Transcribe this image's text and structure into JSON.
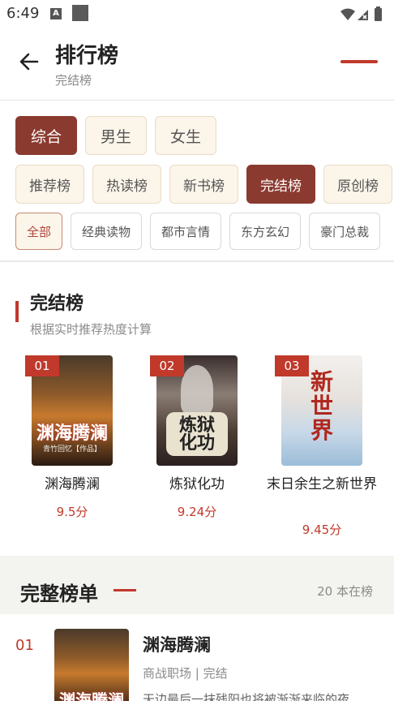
{
  "status_bar": {
    "time": "6:49",
    "notification_badge": "A"
  },
  "header": {
    "title": "排行榜",
    "subtitle": "完结榜"
  },
  "gender_tabs": [
    {
      "label": "综合",
      "active": true
    },
    {
      "label": "男生",
      "active": false
    },
    {
      "label": "女生",
      "active": false
    }
  ],
  "rank_tabs": [
    {
      "label": "推荐榜",
      "active": false
    },
    {
      "label": "热读榜",
      "active": false
    },
    {
      "label": "新书榜",
      "active": false
    },
    {
      "label": "完结榜",
      "active": true
    },
    {
      "label": "原创榜",
      "active": false
    }
  ],
  "category_tabs": [
    {
      "label": "全部",
      "active": true
    },
    {
      "label": "经典读物",
      "active": false
    },
    {
      "label": "都市言情",
      "active": false
    },
    {
      "label": "东方玄幻",
      "active": false
    },
    {
      "label": "豪门总裁",
      "active": false
    }
  ],
  "section": {
    "title": "完结榜",
    "subtitle": "根据实时推荐热度计算"
  },
  "top_books": [
    {
      "rank": "01",
      "title": "渊海腾澜",
      "score": "9.5分",
      "cover_text": "渊海腾澜",
      "cover_author": "青竹回忆【作品】"
    },
    {
      "rank": "02",
      "title": "炼狱化功",
      "score": "9.24分",
      "cover_text": "炼狱化功"
    },
    {
      "rank": "03",
      "title": "末日余生之新世界",
      "score": "9.45分",
      "cover_text": "新世界"
    }
  ],
  "full_list": {
    "title": "完整榜单",
    "count": "20 本在榜",
    "items": [
      {
        "rank": "01",
        "title": "渊海腾澜",
        "meta": "商战职场 | 完结",
        "desc": "天边最后一抹残阳也将被渐渐来临的夜",
        "cover_text": "渊海腾澜"
      }
    ]
  },
  "colors": {
    "accent": "#c0392b",
    "active_chip": "#8b3a2f",
    "chip_bg": "#fcf5ea"
  }
}
